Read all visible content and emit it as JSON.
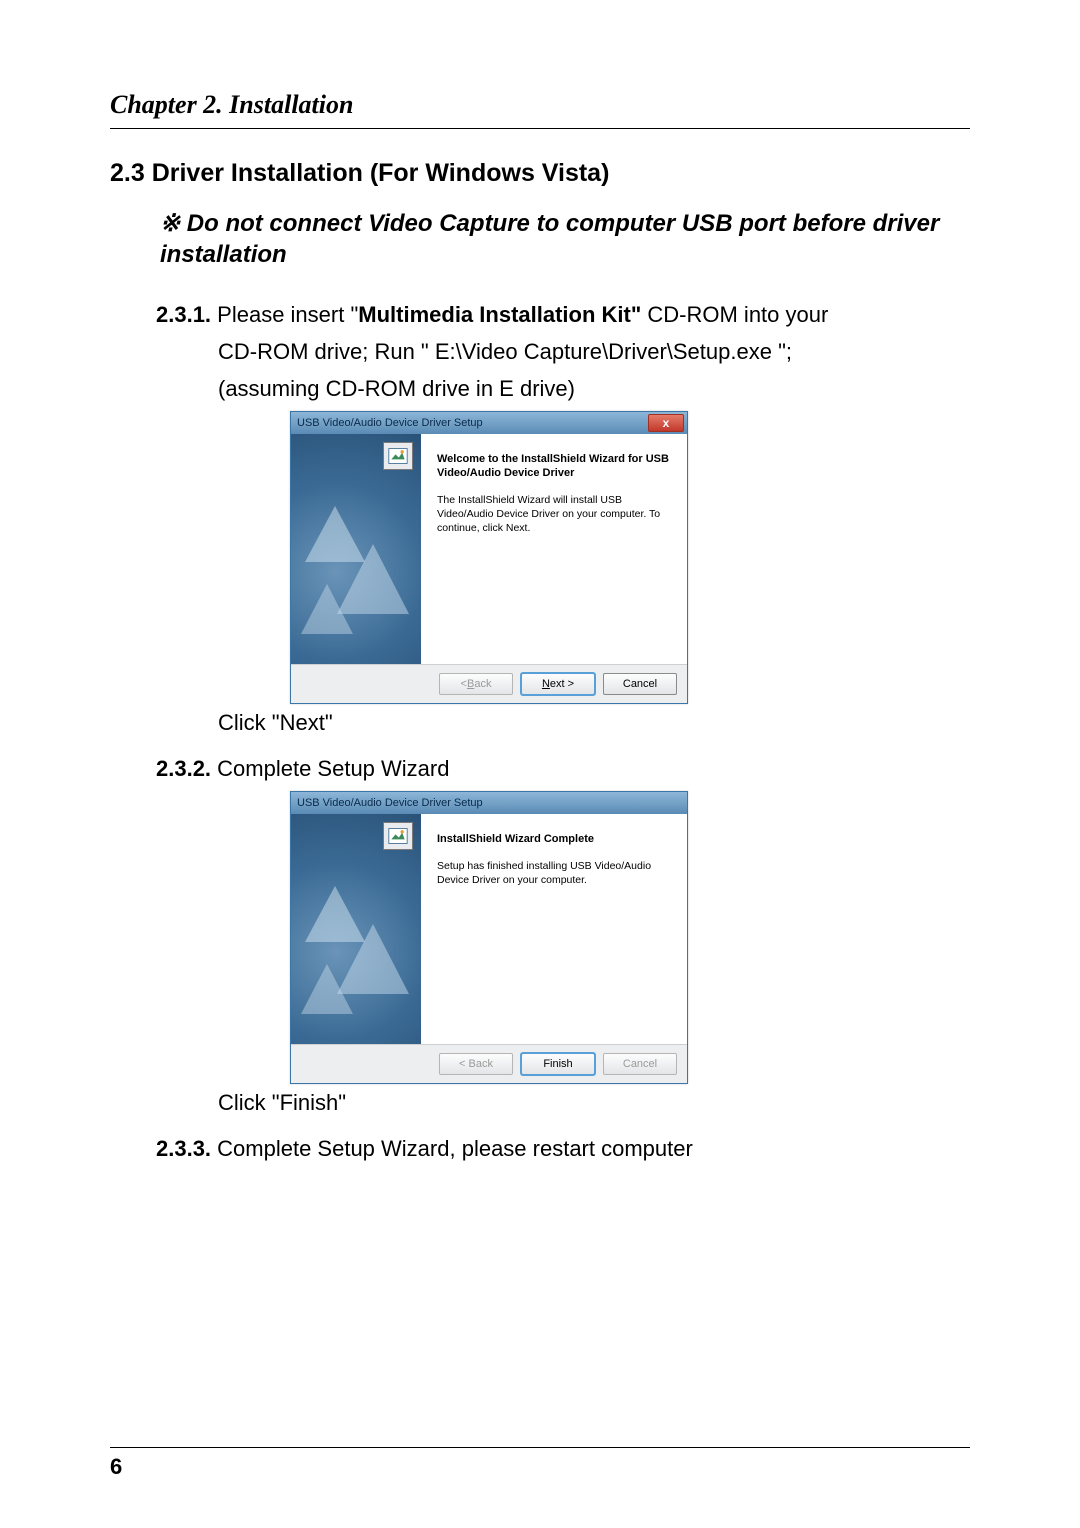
{
  "chapter_header": "Chapter 2. Installation",
  "section_heading": "2.3  Driver Installation (For Windows Vista)",
  "warning_prefix": "※",
  "warning_text": "Do not connect Video Capture to computer USB port before driver installation",
  "step231": {
    "num": "2.3.1.",
    "t1a": " Please insert \"",
    "t1b": "Multimedia Installation Kit\"",
    "t1c": " CD-ROM into your",
    "t2a": "CD-ROM drive; Run \" ",
    "t2b": "E:\\Video Capture\\Driver\\Setup.exe",
    "t2c": " \";",
    "t3": "(assuming CD-ROM drive in E drive)",
    "click_a": "Click \"",
    "click_b": "Next",
    "click_c": "\""
  },
  "step232": {
    "num": "2.3.2.",
    "text": " Complete Setup Wizard",
    "click_a": "Click \"",
    "click_b": "Finish",
    "click_c": "\""
  },
  "step233": {
    "num": "2.3.3.",
    "text": " Complete Setup Wizard, please restart computer"
  },
  "installer1": {
    "title": "USB Video/Audio Device Driver Setup",
    "close": "x",
    "heading": "Welcome to the InstallShield Wizard for USB Video/Audio Device Driver",
    "body": "The InstallShield Wizard will install USB Video/Audio Device Driver on your computer.  To continue, click Next.",
    "back_prefix": "< ",
    "back_u": "B",
    "back_rest": "ack",
    "next_u": "N",
    "next_rest": "ext >",
    "cancel": "Cancel"
  },
  "installer2": {
    "title": "USB Video/Audio Device Driver Setup",
    "heading": "InstallShield Wizard Complete",
    "body": "Setup has finished installing USB Video/Audio Device Driver on your computer.",
    "back": "< Back",
    "finish": "Finish",
    "cancel": "Cancel"
  },
  "page_number": "6"
}
